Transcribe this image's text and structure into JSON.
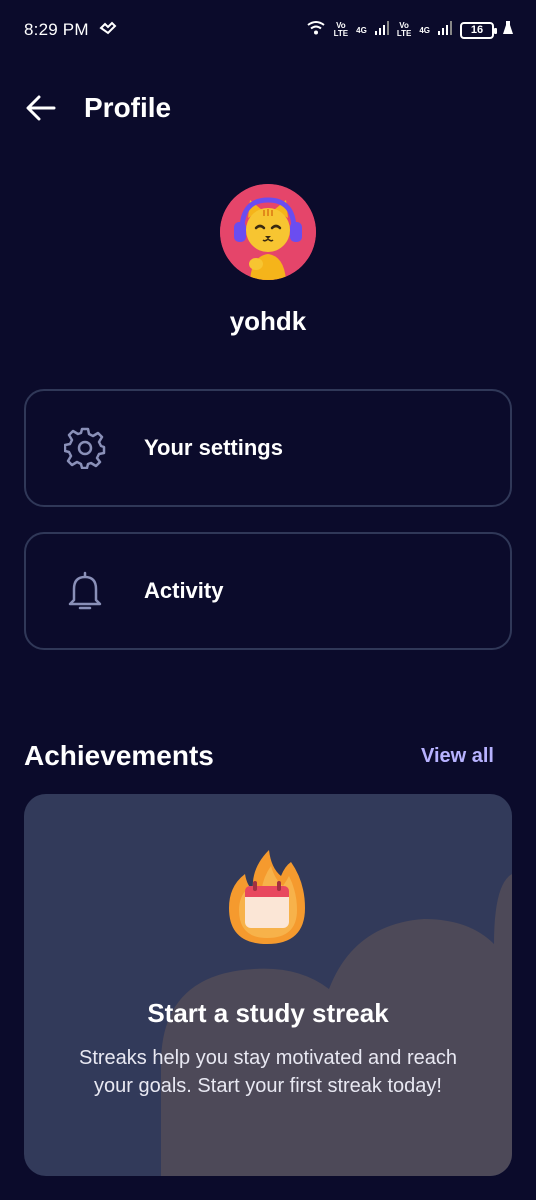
{
  "status_bar": {
    "time": "8:29 PM",
    "net1_top": "Vo",
    "net1_bottom": "LTE",
    "net1_gen": "4G",
    "net2_top": "Vo",
    "net2_bottom": "LTE",
    "net2_gen": "4G",
    "battery": "16"
  },
  "header": {
    "title": "Profile"
  },
  "profile": {
    "username": "yohdk"
  },
  "menu": {
    "settings_label": "Your settings",
    "activity_label": "Activity"
  },
  "achievements": {
    "title": "Achievements",
    "view_all": "View all",
    "card_title": "Start a study streak",
    "card_desc": "Streaks help you stay motivated and reach your goals. Start your first streak today!"
  },
  "colors": {
    "background": "#0b0b2b",
    "card": "#323a5a",
    "accent": "#b7b2ff",
    "avatar_bg": "#e5456a"
  }
}
